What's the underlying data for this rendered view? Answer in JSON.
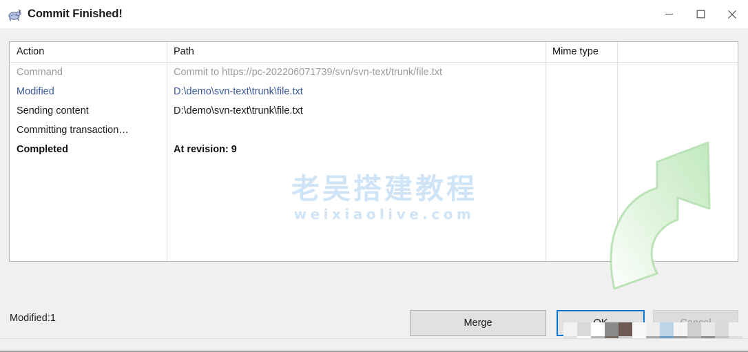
{
  "window": {
    "title": "Commit Finished!",
    "icon": "tortoisesvn-turtle-icon",
    "controls": {
      "minimize": "—",
      "maximize": "☐",
      "close": "✕"
    }
  },
  "list": {
    "columns": [
      {
        "key": "action",
        "label": "Action"
      },
      {
        "key": "path",
        "label": "Path"
      },
      {
        "key": "mime",
        "label": "Mime type"
      }
    ],
    "rows": [
      {
        "action": "Command",
        "path": "Commit to https://pc-202206071739/svn/svn-text/trunk/file.txt",
        "mime": "",
        "tone": "dim"
      },
      {
        "action": "Modified",
        "path": "D:\\demo\\svn-text\\trunk\\file.txt",
        "mime": "",
        "tone": "link"
      },
      {
        "action": "Sending content",
        "path": "D:\\demo\\svn-text\\trunk\\file.txt",
        "mime": "",
        "tone": "normal"
      },
      {
        "action": "Committing transaction…",
        "path": "",
        "mime": "",
        "tone": "normal"
      },
      {
        "action": "Completed",
        "path": "At revision: 9",
        "mime": "",
        "tone": "bold"
      }
    ]
  },
  "artwork": {
    "arrow": "green-commit-arrow-icon",
    "arrow_color": "#cdefcb"
  },
  "watermark": {
    "line1": "老吴搭建教程",
    "line2": "weixiaolive.com",
    "color": "#cfe4f7"
  },
  "footer": {
    "status": "Modified:1",
    "buttons": {
      "merge": "Merge",
      "ok": "OK",
      "cancel": "Cancel"
    }
  },
  "colors": {
    "accent_focus": "#0078d7",
    "link_text": "#3b5998",
    "dim_text": "#9b9b9b",
    "window_bg": "#f0f0f0",
    "list_bg": "#ffffff"
  }
}
